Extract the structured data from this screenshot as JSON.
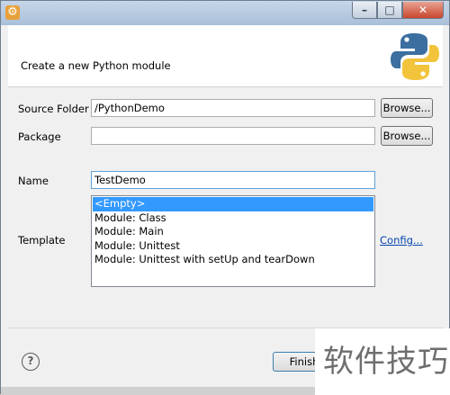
{
  "window": {
    "title": ""
  },
  "header": {
    "message": "Create a new Python module"
  },
  "form": {
    "source_folder_label": "Source Folder",
    "source_folder_value": "/PythonDemo",
    "package_label": "Package",
    "package_value": "",
    "name_label": "Name",
    "name_value": "TestDemo",
    "template_label": "Template",
    "browse_label": "Browse...",
    "config_link": "Config...",
    "templates": [
      "<Empty>",
      "Module: Class",
      "Module: Main",
      "Module: Unittest",
      "Module: Unittest with setUp and tearDown"
    ],
    "selected_template": "<Empty>"
  },
  "footer": {
    "finish_label": "Finish"
  },
  "watermark": {
    "text": "软件技巧"
  },
  "colors": {
    "selection": "#3399ff",
    "link": "#0645ad",
    "python_blue": "#3c6e9f",
    "python_yellow": "#f2c43b"
  },
  "icons": {
    "app": "gear-icon",
    "help": "question-icon",
    "logo": "python-logo-icon"
  }
}
